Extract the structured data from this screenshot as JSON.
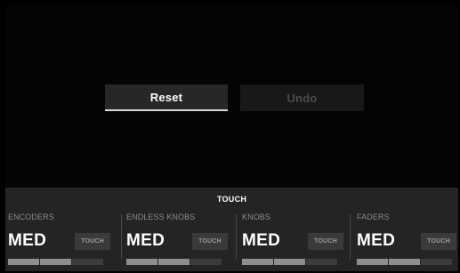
{
  "buttons": {
    "reset_label": "Reset",
    "undo_label": "Undo"
  },
  "panel": {
    "title": "TOUCH",
    "sections": [
      {
        "label": "ENCODERS",
        "value": "MED",
        "touch_label": "TOUCH",
        "level": 2,
        "max_level": 3
      },
      {
        "label": "ENDLESS KNOBS",
        "value": "MED",
        "touch_label": "TOUCH",
        "level": 2,
        "max_level": 3
      },
      {
        "label": "KNOBS",
        "value": "MED",
        "touch_label": "TOUCH",
        "level": 2,
        "max_level": 3
      },
      {
        "label": "FADERS",
        "value": "MED",
        "touch_label": "TOUCH",
        "level": 2,
        "max_level": 3
      }
    ]
  },
  "colors": {
    "background": "#000000",
    "panel": "#242424",
    "button_active": "#272727",
    "button_disabled": "#181818",
    "level_on": "#8e8e8e",
    "level_off": "#3c3c3c"
  }
}
